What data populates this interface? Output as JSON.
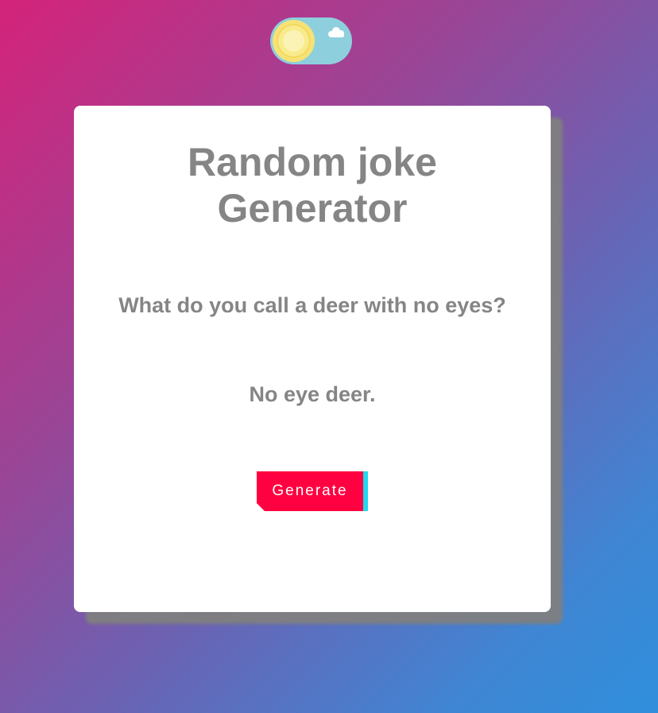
{
  "theme_toggle": {
    "mode": "light",
    "sun_icon": "sun-icon",
    "cloud_icon": "cloud-icon",
    "colors": {
      "track": "#8ecfdd",
      "sun": "#f6e275"
    }
  },
  "card": {
    "title": "Random joke Generator",
    "joke": {
      "question": "What do you call a deer with no eyes?",
      "answer": "No eye deer."
    },
    "generate_button": {
      "label": "Generate"
    }
  },
  "colors": {
    "background_start": "#d4237a",
    "background_end": "#2f8fdc",
    "text": "#858585",
    "button": "#ff0040",
    "button_accent": "#22d8ec"
  }
}
